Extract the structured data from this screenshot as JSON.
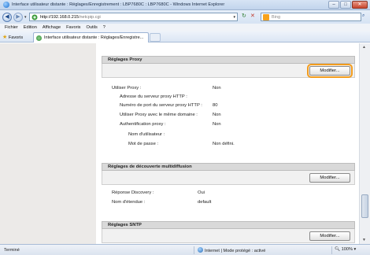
{
  "window": {
    "title": "Interface utilisateur distante : Réglages/Enregistrement : LBP7680C : LBP7680C - Windows Internet Explorer",
    "controls": {
      "minimize": "–",
      "maximize": "□",
      "close": "✕"
    }
  },
  "addressbar": {
    "url_host": "http://192.168.0.215",
    "url_path": "/netcpip.cgi",
    "search_placeholder": "Bing"
  },
  "menu": [
    "Fichier",
    "Edition",
    "Affichage",
    "Favoris",
    "Outils",
    "?"
  ],
  "favorites": {
    "button_label": "Favoris",
    "tab_label": "Interface utilisateur distante : Réglages/Enregistre..."
  },
  "proxy": {
    "title": "Réglages Proxy",
    "modify_label": "Modifier...",
    "rows": [
      {
        "label": "Utiliser Proxy :",
        "value": "Non"
      },
      {
        "label": "Adresse du serveur proxy HTTP :",
        "value": ""
      },
      {
        "label": "Numéro de port du serveur proxy HTTP :",
        "value": "80"
      },
      {
        "label": "Utiliser Proxy avec le même domaine :",
        "value": "Non"
      },
      {
        "label": "Authentification proxy :",
        "value": "Non"
      },
      {
        "label": "Nom d'utilisateur :",
        "value": ""
      },
      {
        "label": "Mot de passe :",
        "value": "Non défini."
      }
    ]
  },
  "multicast": {
    "title": "Réglages de découverte multidiffusion",
    "modify_label": "Modifier...",
    "rows": [
      {
        "label": "Réponse Discovery :",
        "value": "Oui"
      },
      {
        "label": "Nom d'étendue :",
        "value": "default"
      }
    ]
  },
  "sntp": {
    "title": "Réglages SNTP",
    "modify_label": "Modifier..."
  },
  "status": {
    "left": "Terminé",
    "zone": "Internet | Mode protégé : activé",
    "zoom": "100%"
  },
  "colors": {
    "focus_outline": "#f39c1d",
    "section_header": "#d9d9d9",
    "left_panel": "#eceae8"
  }
}
